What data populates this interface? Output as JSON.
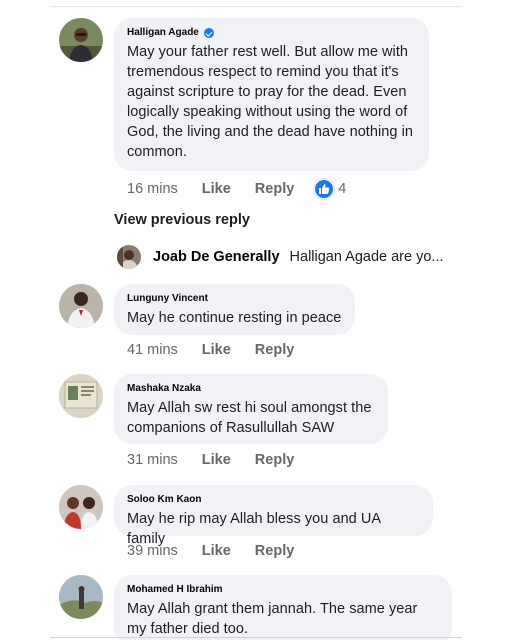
{
  "comments": [
    {
      "author": "Halligan Agade",
      "verified": true,
      "text": "May your father rest well. But allow me with tremendous respect to remind you that it's against scripture to pray for the dead. Even logically speaking without using the word of God, the living and the dead have nothing in common.",
      "time": "16 mins",
      "like_label": "Like",
      "reply_label": "Reply",
      "reaction_count": "4",
      "reaction_icon": "thumbs-up-icon"
    },
    {
      "author": "Lunguny Vincent",
      "text": "May he continue resting in peace",
      "time": "41 mins",
      "like_label": "Like",
      "reply_label": "Reply"
    },
    {
      "author": "Mashaka Nzaka",
      "text": "May Allah sw rest hi soul amongst the companions of Rasullullah SAW",
      "time": "31 mins",
      "like_label": "Like",
      "reply_label": "Reply"
    },
    {
      "author": "Soloo Km Kaon",
      "text": "May he rip may Allah bless you and UA family",
      "time": "39 mins",
      "like_label": "Like",
      "reply_label": "Reply"
    },
    {
      "author": "Mohamed H Ibrahim",
      "text": "May Allah grant them  jannah. The same year my father died too."
    }
  ],
  "view_previous_reply": "View previous reply",
  "reply_preview": {
    "author": "Joab De Generally",
    "text": "Halligan Agade are yo..."
  },
  "colors": {
    "bubble": "#f0f2f5",
    "accent": "#1877f2",
    "secondary_text": "#65676b"
  }
}
